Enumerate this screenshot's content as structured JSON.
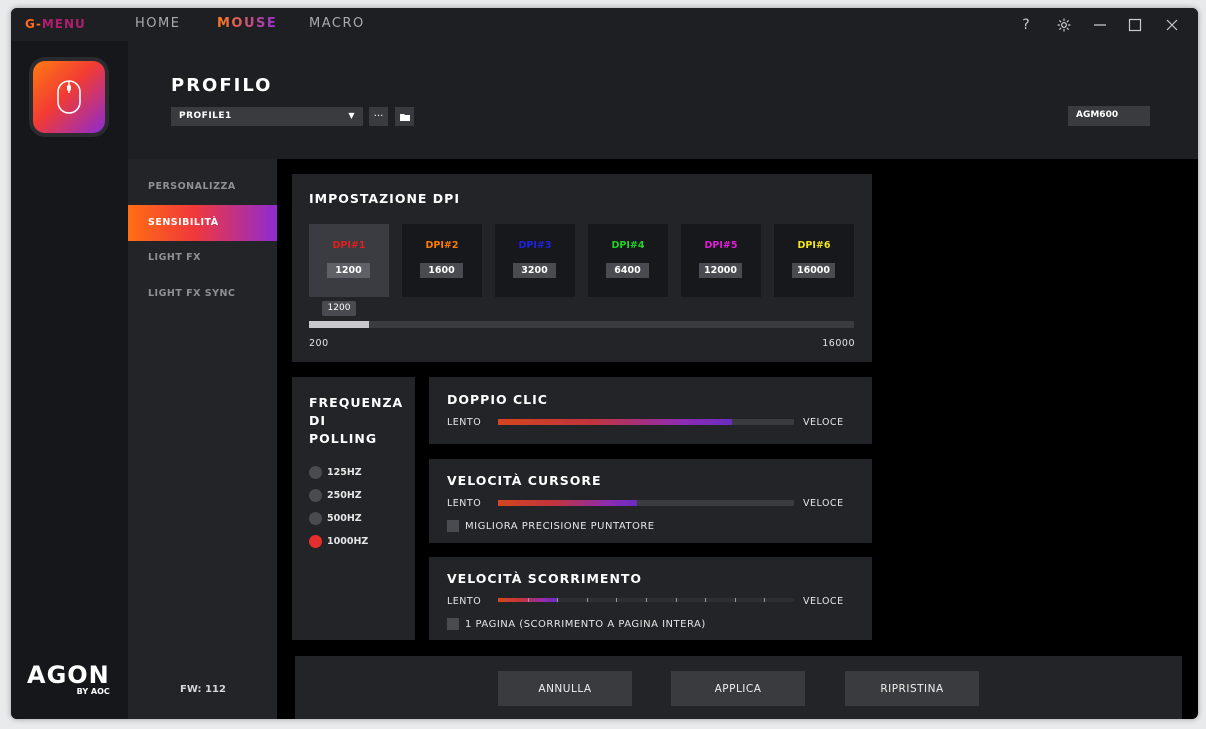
{
  "topbar": {
    "brand_part1": "G-",
    "brand_part2": "MENU",
    "tabs": [
      "HOME",
      "MOUSE",
      "MACRO"
    ],
    "active_tab": "MOUSE",
    "help": "?"
  },
  "rail": {
    "logo_big": "AGON",
    "logo_small": "BY AOC"
  },
  "header": {
    "title": "PROFILO",
    "profile_value": "PROFILE1",
    "more_button": "···",
    "model": "AGM600"
  },
  "submenu": {
    "items": [
      "PERSONALIZZA",
      "SENSIBILITÀ",
      "LIGHT FX",
      "LIGHT FX SYNC"
    ],
    "active": "SENSIBILITÀ",
    "fw": "FW: 112"
  },
  "dpi": {
    "title": "IMPOSTAZIONE DPI",
    "cards": [
      {
        "label": "DPI#1",
        "value": "1200",
        "color": "#e01f1f"
      },
      {
        "label": "DPI#2",
        "value": "1600",
        "color": "#ff7a00"
      },
      {
        "label": "DPI#3",
        "value": "3200",
        "color": "#2020e0"
      },
      {
        "label": "DPI#4",
        "value": "6400",
        "color": "#23d12a"
      },
      {
        "label": "DPI#5",
        "value": "12000",
        "color": "#e01ed8"
      },
      {
        "label": "DPI#6",
        "value": "16000",
        "color": "#f2e51d"
      }
    ],
    "active_index": 0,
    "tooltip": "1200",
    "min": "200",
    "max": "16000",
    "current": 1200
  },
  "polling": {
    "title_lines": [
      "FREQUENZA",
      "DI",
      "POLLING"
    ],
    "options": [
      "125HZ",
      "250HZ",
      "500HZ",
      "1000HZ"
    ],
    "selected": "1000HZ"
  },
  "double_click": {
    "title": "DOPPIO CLIC",
    "left": "LENTO",
    "right": "VELOCE",
    "level": 0.79
  },
  "cursor_speed": {
    "title": "VELOCITÀ CURSORE",
    "left": "LENTO",
    "right": "VELOCE",
    "level": 0.47,
    "checkbox": "MIGLIORA PRECISIONE PUNTATORE"
  },
  "scroll_speed": {
    "title": "VELOCITÀ SCORRIMENTO",
    "left": "LENTO",
    "right": "VELOCE",
    "level": 0.2,
    "ticks": 10,
    "checkbox": "1 PAGINA (SCORRIMENTO A PAGINA INTERA)"
  },
  "footer": {
    "cancel": "ANNULLA",
    "apply": "APPLICA",
    "reset": "RIPRISTINA"
  }
}
